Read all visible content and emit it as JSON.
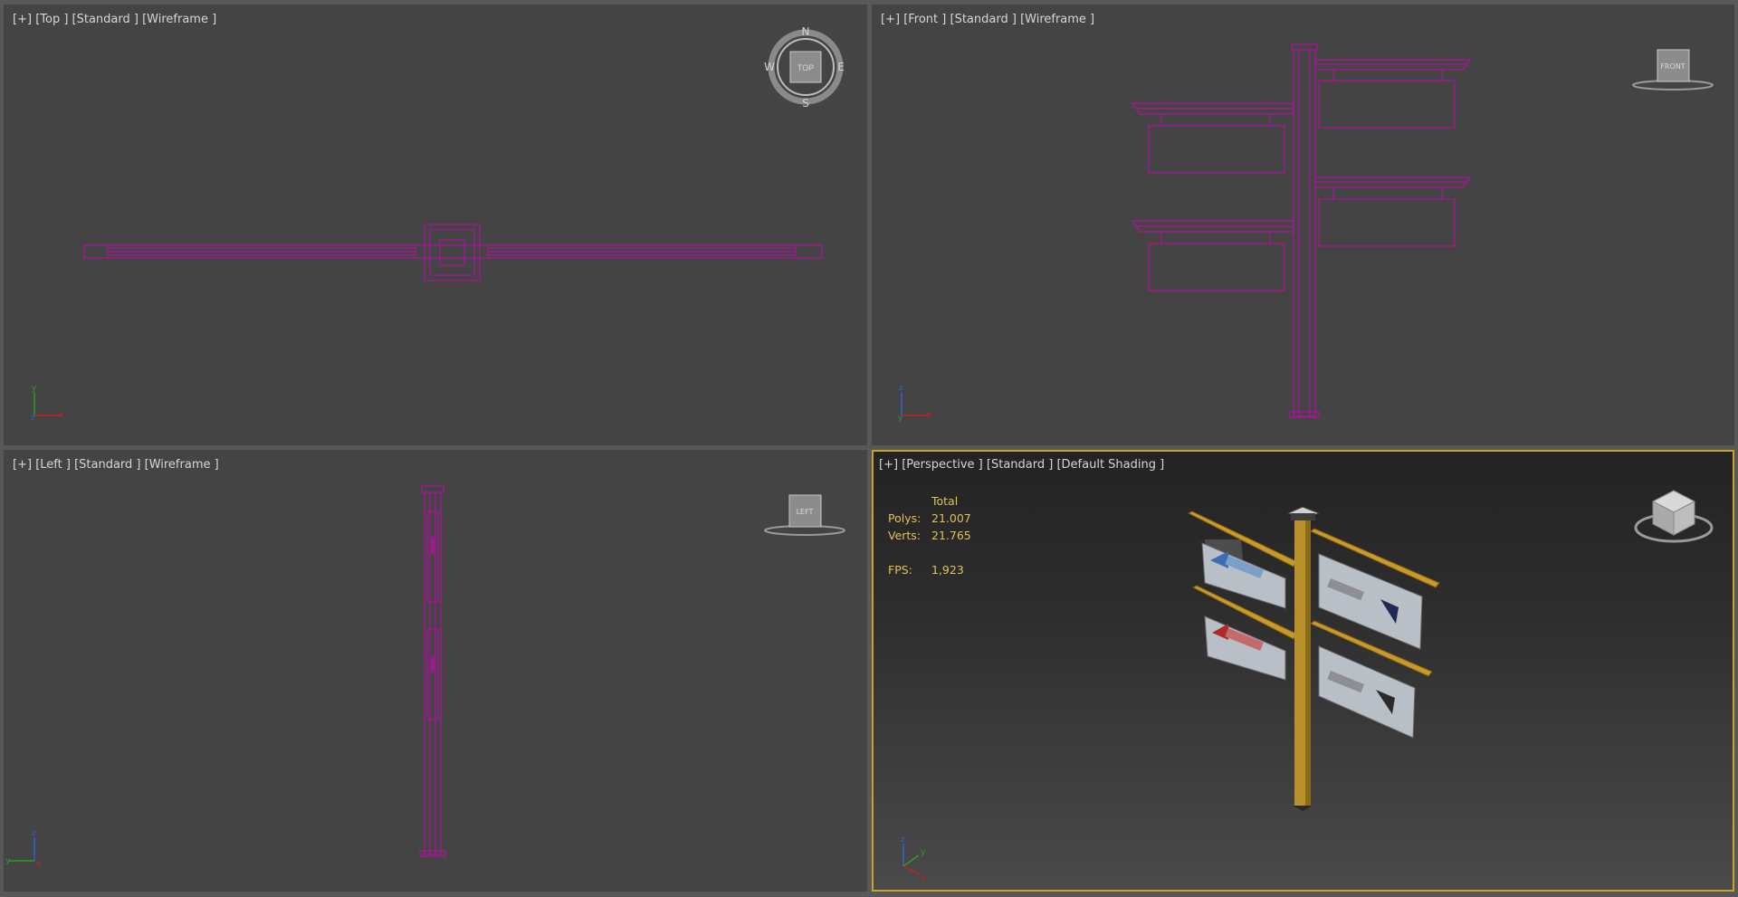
{
  "viewports": {
    "top": {
      "menu": "[+]",
      "view": "[Top ]",
      "render": "[Standard ]",
      "shading": "[Wireframe ]",
      "compass": {
        "n": "N",
        "e": "E",
        "s": "S",
        "w": "W",
        "face": "TOP"
      }
    },
    "front": {
      "menu": "[+]",
      "view": "[Front ]",
      "render": "[Standard ]",
      "shading": "[Wireframe ]",
      "viewcube_face": "FRONT"
    },
    "left": {
      "menu": "[+]",
      "view": "[Left ]",
      "render": "[Standard ]",
      "shading": "[Wireframe ]",
      "viewcube_face": "LEFT"
    },
    "perspective": {
      "menu": "[+]",
      "view": "[Perspective ]",
      "render": "[Standard ]",
      "shading": "[Default Shading ]",
      "active": true
    }
  },
  "stats": {
    "header": "Total",
    "polys_label": "Polys:",
    "polys_value": "21.007",
    "verts_label": "Verts:",
    "verts_value": "21.765",
    "fps_label": "FPS:",
    "fps_value": "1,923"
  },
  "axes": {
    "x": "x",
    "y": "y",
    "z": "z"
  },
  "colors": {
    "wireframe": "#b0119f",
    "stats_text": "#e0c15a",
    "active_border": "#c9a227",
    "post": "#b8902c"
  }
}
